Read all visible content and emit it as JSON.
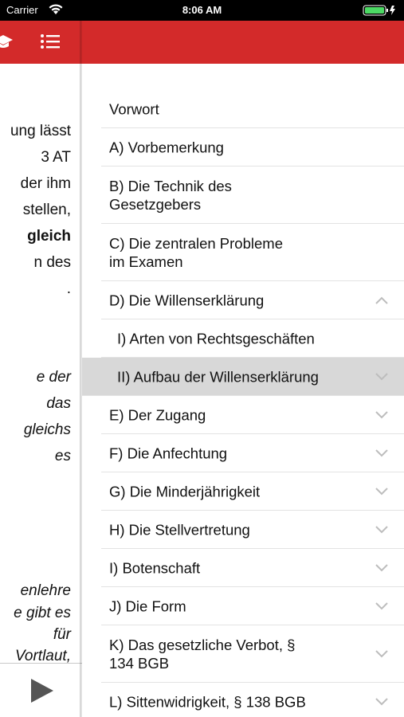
{
  "status_bar": {
    "carrier": "Carrier",
    "time": "8:06 AM"
  },
  "colors": {
    "header": "#d32a2a",
    "selected_row": "#d8d8d8",
    "battery": "#4cd964"
  },
  "left_panel": {
    "lines": [
      {
        "text": "ung lässt",
        "style": "normal"
      },
      {
        "text": "3 AT",
        "style": "normal"
      },
      {
        "text": "der ihm",
        "style": "normal"
      },
      {
        "text": "stellen,",
        "style": "normal"
      },
      {
        "text": "gleich",
        "style": "bold"
      },
      {
        "text": "n des",
        "style": "normal"
      },
      {
        "text": ".",
        "style": "normal"
      },
      {
        "text": "e der",
        "style": "italic"
      },
      {
        "text": "das",
        "style": "italic"
      },
      {
        "text": "gleichs",
        "style": "italic"
      },
      {
        "text": "es",
        "style": "italic"
      },
      {
        "text": "enlehre",
        "style": "italic"
      },
      {
        "text": "e gibt es",
        "style": "italic"
      },
      {
        "text": "für",
        "style": "italic"
      },
      {
        "text": "Vortlaut,",
        "style": "italic"
      }
    ]
  },
  "toc": {
    "items": [
      {
        "label": "Vorwort",
        "lines": 1,
        "chevron": "none"
      },
      {
        "label": "A) Vorbemerkung",
        "lines": 1,
        "chevron": "none"
      },
      {
        "label": "B) Die Technik des\nGesetzgebers",
        "lines": 2,
        "chevron": "none"
      },
      {
        "label": "C) Die zentralen Probleme\nim Examen",
        "lines": 2,
        "chevron": "none"
      },
      {
        "label": "D) Die Willenserklärung",
        "lines": 1,
        "chevron": "up"
      },
      {
        "label": "I) Arten von Rechtsgeschäften",
        "lines": 1,
        "chevron": "none",
        "sub": true
      },
      {
        "label": "II) Aufbau der Willenserklärung",
        "lines": 1,
        "chevron": "down",
        "sub": true,
        "selected": true
      },
      {
        "label": "E) Der Zugang",
        "lines": 1,
        "chevron": "down"
      },
      {
        "label": "F) Die Anfechtung",
        "lines": 1,
        "chevron": "down"
      },
      {
        "label": "G) Die Minderjährigkeit",
        "lines": 1,
        "chevron": "down"
      },
      {
        "label": "H) Die Stellvertretung",
        "lines": 1,
        "chevron": "down"
      },
      {
        "label": "I) Botenschaft",
        "lines": 1,
        "chevron": "down"
      },
      {
        "label": "J) Die Form",
        "lines": 1,
        "chevron": "down"
      },
      {
        "label": "K) Das gesetzliche Verbot, §\n134 BGB",
        "lines": 2,
        "chevron": "down"
      },
      {
        "label": "L) Sittenwidrigkeit, § 138 BGB",
        "lines": 1,
        "chevron": "down"
      }
    ]
  }
}
